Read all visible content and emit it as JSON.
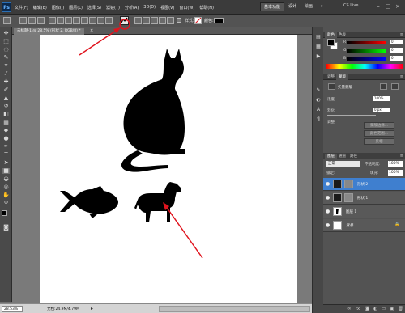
{
  "app": {
    "logo": "Ps",
    "menus": [
      "文件(F)",
      "编辑(E)",
      "图像(I)",
      "图层(L)",
      "选择(S)",
      "滤镜(T)",
      "分析(A)",
      "3D(D)",
      "视图(V)",
      "窗口(W)",
      "帮助(H)"
    ],
    "workspace": {
      "primary": "基本功能",
      "design": "设计",
      "paint": "绘画",
      "more": "»"
    },
    "cs_live": "CS Live",
    "window_controls": {
      "minimize": "–",
      "restore": "□",
      "close": "×"
    }
  },
  "options_bar": {
    "style_label": "样式:",
    "color_label": "颜色:",
    "color_value": "#000000"
  },
  "document": {
    "tab_label": "未标题-1 @ 28.5% (形状 2, RGB/8) *",
    "tab_close": "×",
    "zoom": "28.53%",
    "doc_info": "文档:24.9M/4.79M",
    "status_arrow": "▸"
  },
  "canvas": {
    "background": "#ffffff",
    "shape_color": "#000000",
    "annotation_color": "#e0141e",
    "shapes": [
      "cat",
      "fish",
      "dog"
    ]
  },
  "color_panel": {
    "tabs": [
      "颜色",
      "色板"
    ],
    "channels": [
      {
        "label": "R",
        "value": "0"
      },
      {
        "label": "G",
        "value": "0"
      },
      {
        "label": "B",
        "value": "0"
      }
    ]
  },
  "masks_panel": {
    "tabs": [
      "调整",
      "蒙版"
    ],
    "title": "矢量蒙版",
    "density_label": "浓度:",
    "density_value": "100%",
    "feather_label": "羽化:",
    "feather_value": "0 px",
    "refine_label": "调整:",
    "buttons": [
      "蒙版边缘...",
      "颜色范围...",
      "反相"
    ]
  },
  "layers_panel": {
    "tabs": [
      "图层",
      "通道",
      "路径"
    ],
    "blend_mode": "正常",
    "opacity_label": "不透明度:",
    "opacity_value": "100%",
    "lock_label": "锁定:",
    "fill_label": "填充:",
    "fill_value": "100%",
    "layers": [
      {
        "name": "形状 2",
        "active": true
      },
      {
        "name": "形状 1",
        "active": false
      },
      {
        "name": "图层 1",
        "active": false
      },
      {
        "name": "背景",
        "active": false
      }
    ],
    "footer_icons": [
      "link-icon",
      "fx-icon",
      "mask-icon",
      "adjustment-icon",
      "folder-icon",
      "new-layer-icon",
      "trash-icon"
    ]
  }
}
